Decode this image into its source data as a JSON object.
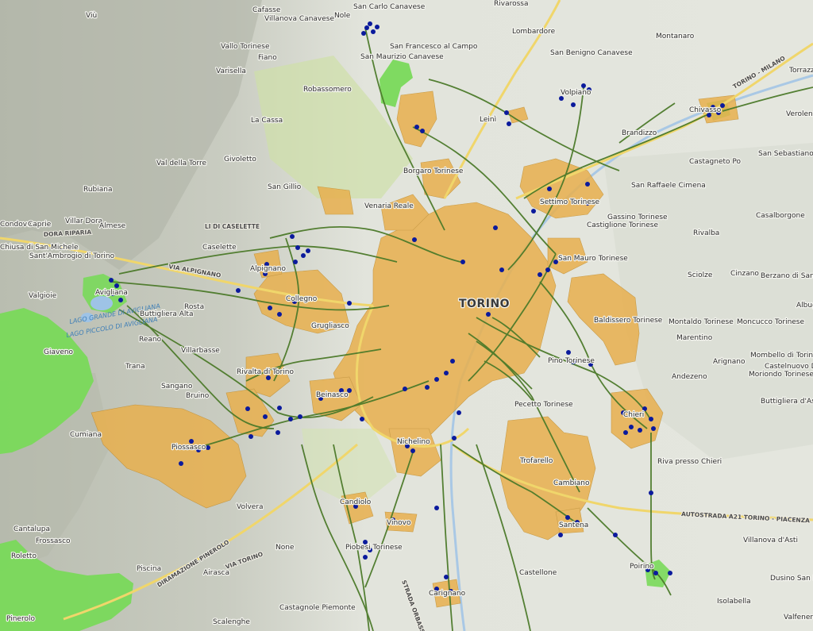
{
  "map": {
    "city_label": "TORINO",
    "colors": {
      "urban_area": "#e8b04e",
      "protected_area": "#7ddc5e",
      "network_lines": "#4c7a2a",
      "stop_points": "#0b1a9c",
      "motorway": "#f0d66b",
      "water": "#9ec3e6"
    },
    "places": [
      {
        "text": "Viù"
      },
      {
        "text": "Cafasse"
      },
      {
        "text": "Villanova Canavese"
      },
      {
        "text": "Nole"
      },
      {
        "text": "San Carlo Canavese"
      },
      {
        "text": "Rivarossa"
      },
      {
        "text": "Lombardore"
      },
      {
        "text": "Vallo Torinese"
      },
      {
        "text": "Fiano"
      },
      {
        "text": "San Francesco al Campo"
      },
      {
        "text": "San Maurizio Canavese"
      },
      {
        "text": "San Benigno Canavese"
      },
      {
        "text": "Montanaro"
      },
      {
        "text": "Varisella"
      },
      {
        "text": "Robassomero"
      },
      {
        "text": "Volpiano"
      },
      {
        "text": "Torrazza"
      },
      {
        "text": "La Cassa"
      },
      {
        "text": "Leinì"
      },
      {
        "text": "Brandizzo"
      },
      {
        "text": "Chivasso"
      },
      {
        "text": "Verolengo"
      },
      {
        "text": "Val della Torre"
      },
      {
        "text": "Givoletto"
      },
      {
        "text": "San Sebastiano da Po"
      },
      {
        "text": "Borgaro Torinese"
      },
      {
        "text": "Castagneto Po"
      },
      {
        "text": "Rubiana"
      },
      {
        "text": "San Gillio"
      },
      {
        "text": "San Raffaele Cimena"
      },
      {
        "text": "Settimo Torinese"
      },
      {
        "text": "Villar Dora"
      },
      {
        "text": "Almese"
      },
      {
        "text": "Venaria Reale"
      },
      {
        "text": "Gassino Torinese"
      },
      {
        "text": "Casalborgone"
      },
      {
        "text": "Condove"
      },
      {
        "text": "Caprie"
      },
      {
        "text": "Castiglione Torinese"
      },
      {
        "text": "Rivalba"
      },
      {
        "text": "Chiusa di San Michele"
      },
      {
        "text": "Caselette"
      },
      {
        "text": "Sant'Ambrogio di Torino"
      },
      {
        "text": "San Mauro Torinese"
      },
      {
        "text": "Alpignano"
      },
      {
        "text": "Sciolze"
      },
      {
        "text": "Cinzano"
      },
      {
        "text": "Berzano di San Pietro"
      },
      {
        "text": "Valgioie"
      },
      {
        "text": "Avigliana"
      },
      {
        "text": "Collegno"
      },
      {
        "text": "Rosta"
      },
      {
        "text": "Albugnano"
      },
      {
        "text": "Buttigliera Alta"
      },
      {
        "text": "Grugliasco"
      },
      {
        "text": "Baldissero Torinese"
      },
      {
        "text": "Montaldo Torinese"
      },
      {
        "text": "Moncucco Torinese"
      },
      {
        "text": "Giaveno"
      },
      {
        "text": "Reano"
      },
      {
        "text": "Marentino"
      },
      {
        "text": "Villarbasse"
      },
      {
        "text": "Pino Torinese"
      },
      {
        "text": "Arignano"
      },
      {
        "text": "Mombello di Torino"
      },
      {
        "text": "Castelnuovo Don Bosco"
      },
      {
        "text": "Moriondo Torinese"
      },
      {
        "text": "Trana"
      },
      {
        "text": "Rivalta di Torino"
      },
      {
        "text": "Andezeno"
      },
      {
        "text": "Sangano"
      },
      {
        "text": "Bruino"
      },
      {
        "text": "Beinasco"
      },
      {
        "text": "Buttigliera d'Asti"
      },
      {
        "text": "Pecetto Torinese"
      },
      {
        "text": "Chieri"
      },
      {
        "text": "Piossasco"
      },
      {
        "text": "Cumiana"
      },
      {
        "text": "Nichelino"
      },
      {
        "text": "Trofarello"
      },
      {
        "text": "Riva presso Chieri"
      },
      {
        "text": "Cambiano"
      },
      {
        "text": "Volvera"
      },
      {
        "text": "Candiolo"
      },
      {
        "text": "Santena"
      },
      {
        "text": "Cantalupa"
      },
      {
        "text": "Vinovo"
      },
      {
        "text": "Frossasco"
      },
      {
        "text": "None"
      },
      {
        "text": "Piobesi Torinese"
      },
      {
        "text": "Roletto"
      },
      {
        "text": "Villanova d'Asti"
      },
      {
        "text": "Piscina"
      },
      {
        "text": "Airasca"
      },
      {
        "text": "Castellone"
      },
      {
        "text": "Dusino San Michele"
      },
      {
        "text": "Poirino"
      },
      {
        "text": "Isolabella"
      },
      {
        "text": "Carignano"
      },
      {
        "text": "Pinerolo"
      },
      {
        "text": "Scalenghe"
      },
      {
        "text": "Castagnole Piemonte"
      },
      {
        "text": "Valfenera"
      }
    ],
    "road_labels": [
      {
        "text": "AUTOSTRADA A21 TORINO - PIACENZA"
      },
      {
        "text": "DIRAMAZIONE PINEROLO"
      },
      {
        "text": "VIA TORINO"
      },
      {
        "text": "STRADA ORBASSANO"
      },
      {
        "text": "VIA ALPIGNANO"
      },
      {
        "text": "DORA RIPARIA"
      },
      {
        "text": "LI DI CASELETTE"
      },
      {
        "text": "TORINO - MILANO"
      }
    ],
    "water_labels": [
      {
        "text": "LAGO GRANDE DI AVIGLIANA"
      },
      {
        "text": "LAGO PICCOLO DI AVIGLIANA"
      }
    ]
  }
}
